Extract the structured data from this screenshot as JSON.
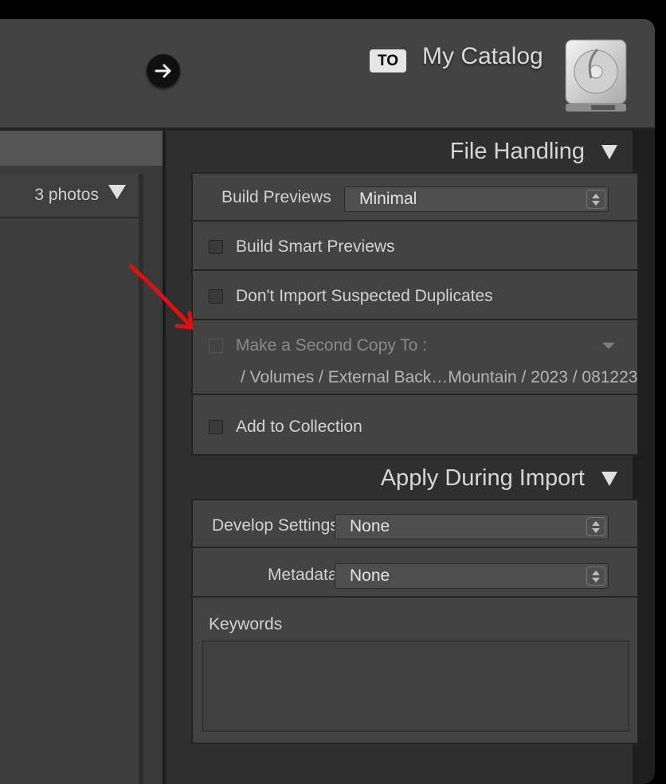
{
  "header": {
    "destination_badge": "TO",
    "catalog_title": "My Catalog",
    "forward_icon": "arrow-right-icon",
    "drive_icon": "hard-drive-icon"
  },
  "left_panel": {
    "photos_count": "3 photos",
    "collapse_icon": "triangle-down-icon"
  },
  "file_handling": {
    "title": "File Handling",
    "build_previews_label": "Build Previews",
    "build_previews_value": "Minimal",
    "build_smart_previews_label": "Build Smart Previews",
    "build_smart_previews_checked": false,
    "dont_import_duplicates_label": "Don't Import Suspected Duplicates",
    "dont_import_duplicates_checked": false,
    "second_copy_label": "Make a Second Copy To :",
    "second_copy_checked": false,
    "second_copy_path": "/ Volumes / External Back…Mountain / 2023 / 081223",
    "add_to_collection_label": "Add to Collection",
    "add_to_collection_checked": false
  },
  "apply_during_import": {
    "title": "Apply During Import",
    "develop_settings_label": "Develop Settings",
    "develop_settings_value": "None",
    "metadata_label": "Metadata",
    "metadata_value": "None",
    "keywords_label": "Keywords",
    "keywords_value": ""
  },
  "colors": {
    "annotation_arrow": "#e01010",
    "panel_bg": "#434343",
    "topbar_bg": "#434343"
  }
}
